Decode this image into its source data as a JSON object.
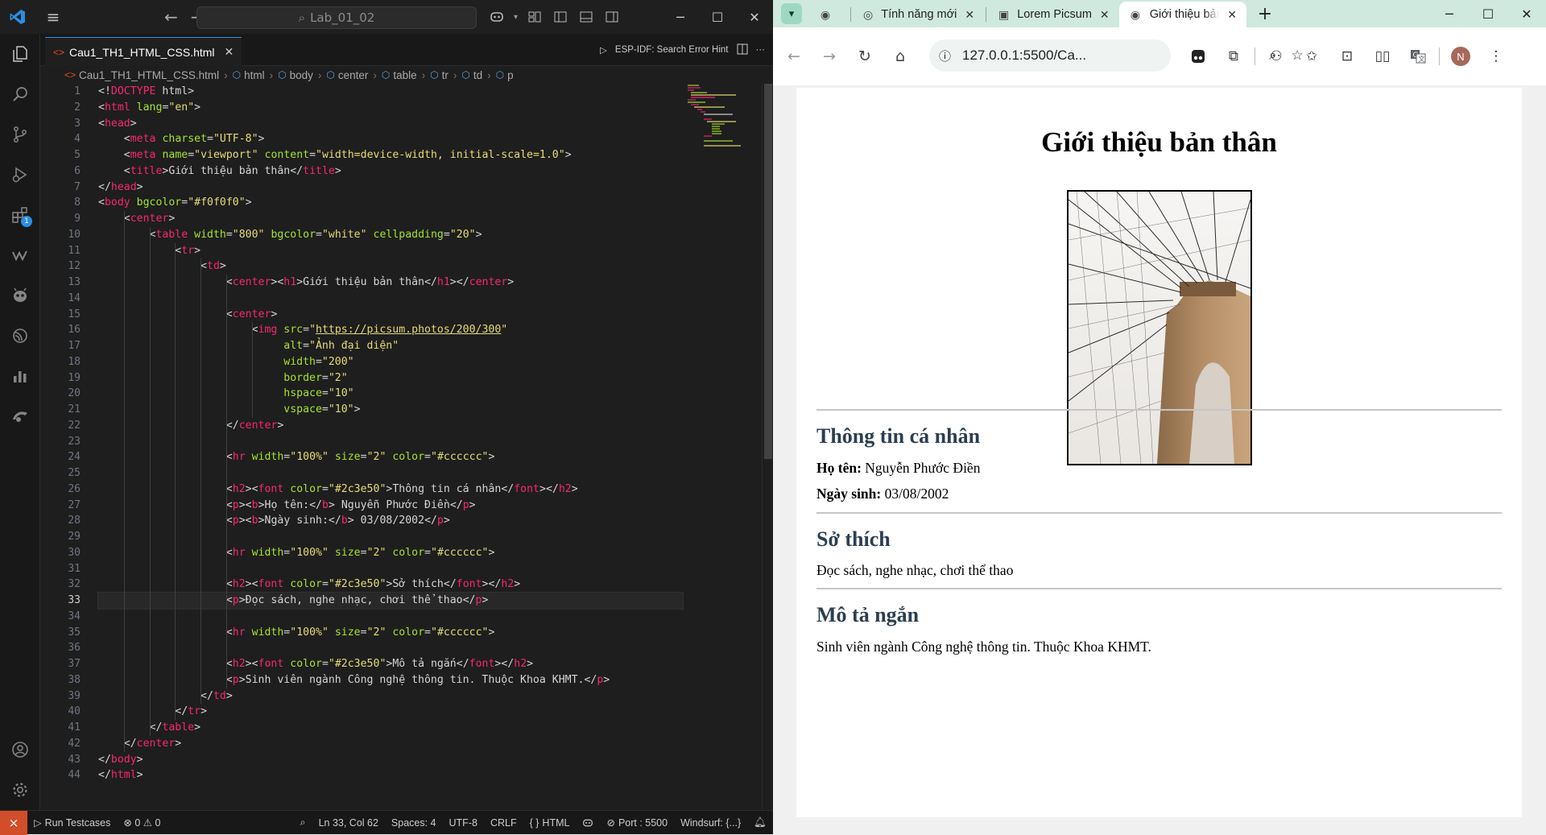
{
  "vscode": {
    "search_text": "Lab_01_02",
    "tab_label": "Cau1_TH1_HTML_CSS.html",
    "tab_action_label": "ESP-IDF: Search Error Hint",
    "breadcrumb": [
      "Cau1_TH1_HTML_CSS.html",
      "html",
      "body",
      "center",
      "table",
      "tr",
      "td",
      "p"
    ],
    "extensions_badge": "1",
    "code_lines": [
      "<!DOCTYPE html>",
      "<html lang=\"en\">",
      "<head>",
      "    <meta charset=\"UTF-8\">",
      "    <meta name=\"viewport\" content=\"width=device-width, initial-scale=1.0\">",
      "    <title>Giới thiệu bản thân</title>",
      "</head>",
      "<body bgcolor=\"#f0f0f0\">",
      "    <center>",
      "        <table width=\"800\" bgcolor=\"white\" cellpadding=\"20\">",
      "            <tr>",
      "                <td>",
      "                    <center><h1>Giới thiệu bản thân</h1></center>",
      "",
      "                    <center>",
      "                        <img src=\"https://picsum.photos/200/300\"",
      "                             alt=\"Ảnh đại diện\"",
      "                             width=\"200\"",
      "                             border=\"2\"",
      "                             hspace=\"10\"",
      "                             vspace=\"10\">",
      "                    </center>",
      "",
      "                    <hr width=\"100%\" size=\"2\" color=\"#cccccc\">",
      "",
      "                    <h2><font color=\"#2c3e50\">Thông tin cá nhân</font></h2>",
      "                    <p><b>Họ tên:</b> Nguyễn Phước Điền</p>",
      "                    <p><b>Ngày sinh:</b> 03/08/2002</p>",
      "",
      "                    <hr width=\"100%\" size=\"2\" color=\"#cccccc\">",
      "",
      "                    <h2><font color=\"#2c3e50\">Sở thích</font></h2>",
      "                    <p>Đọc sách, nghe nhạc, chơi thể thao</p>",
      "",
      "                    <hr width=\"100%\" size=\"2\" color=\"#cccccc\">",
      "",
      "                    <h2><font color=\"#2c3e50\">Mô tả ngắn</font></h2>",
      "                    <p>Sinh viên ngành Công nghệ thông tin. Thuộc Khoa KHMT.</p>",
      "                </td>",
      "            </tr>",
      "        </table>",
      "    </center>",
      "</body>",
      "</html>"
    ],
    "current_line": 33,
    "status": {
      "run_testcases": "Run Testcases",
      "problems": "⊗ 0 ⚠ 0",
      "position": "Ln 33, Col 62",
      "spaces": "Spaces: 4",
      "encoding": "UTF-8",
      "eol": "CRLF",
      "language": "HTML",
      "port": "Port : 5500",
      "windsurf": "Windsurf: {...}"
    }
  },
  "browser": {
    "tabs": [
      {
        "label": "Tính năng mới",
        "icon": "chrome-icon"
      },
      {
        "label": "Lorem Picsum",
        "icon": "picture-icon"
      },
      {
        "label": "Giới thiệu bản t",
        "icon": "globe-icon",
        "active": true
      }
    ],
    "url": "127.0.0.1:5500/Ca...",
    "avatar_initial": "N",
    "page": {
      "title": "Giới thiệu bản thân",
      "image_alt": "Ảnh đại diện",
      "section1_heading": "Thông tin cá nhân",
      "name_label": "Họ tên:",
      "name_value": " Nguyễn Phước Điền",
      "dob_label": "Ngày sinh:",
      "dob_value": " 03/08/2002",
      "section2_heading": "Sở thích",
      "hobbies": "Đọc sách, nghe nhạc, chơi thể thao",
      "section3_heading": "Mô tả ngắn",
      "description": "Sinh viên ngành Công nghệ thông tin. Thuộc Khoa KHMT."
    }
  },
  "colors": {
    "heading": "#2c3e50",
    "accent_vscode": "#2b8ee6",
    "remote_indicator": "#d24e2a",
    "browser_frame": "#cfe9de"
  }
}
